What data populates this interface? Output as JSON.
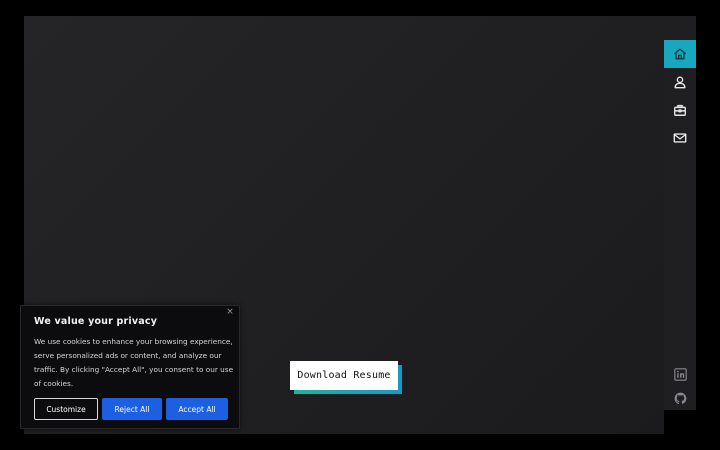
{
  "colors": {
    "background": "#000000",
    "panel": "#222224",
    "sidebar": "#1f1f21",
    "accent": "#17a8c0",
    "button_shadow_start": "#16b79c",
    "button_shadow_end": "#1599c9",
    "cookie_button": "#1c5fe0"
  },
  "sidebar": {
    "nav_items": [
      {
        "icon": "home-icon",
        "active": true
      },
      {
        "icon": "user-icon",
        "active": false
      },
      {
        "icon": "briefcase-icon",
        "active": false
      },
      {
        "icon": "mail-icon",
        "active": false
      }
    ],
    "social_items": [
      {
        "icon": "linkedin-icon"
      },
      {
        "icon": "github-icon"
      }
    ]
  },
  "main": {
    "download_label": "Download Resume"
  },
  "cookie_banner": {
    "close_label": "×",
    "title": "We value your privacy",
    "text": "We use cookies to enhance your browsing experience, serve personalized ads or content, and analyze our traffic. By clicking \"Accept All\", you consent to our use of cookies.",
    "customize_label": "Customize",
    "reject_label": "Reject All",
    "accept_label": "Accept All"
  }
}
